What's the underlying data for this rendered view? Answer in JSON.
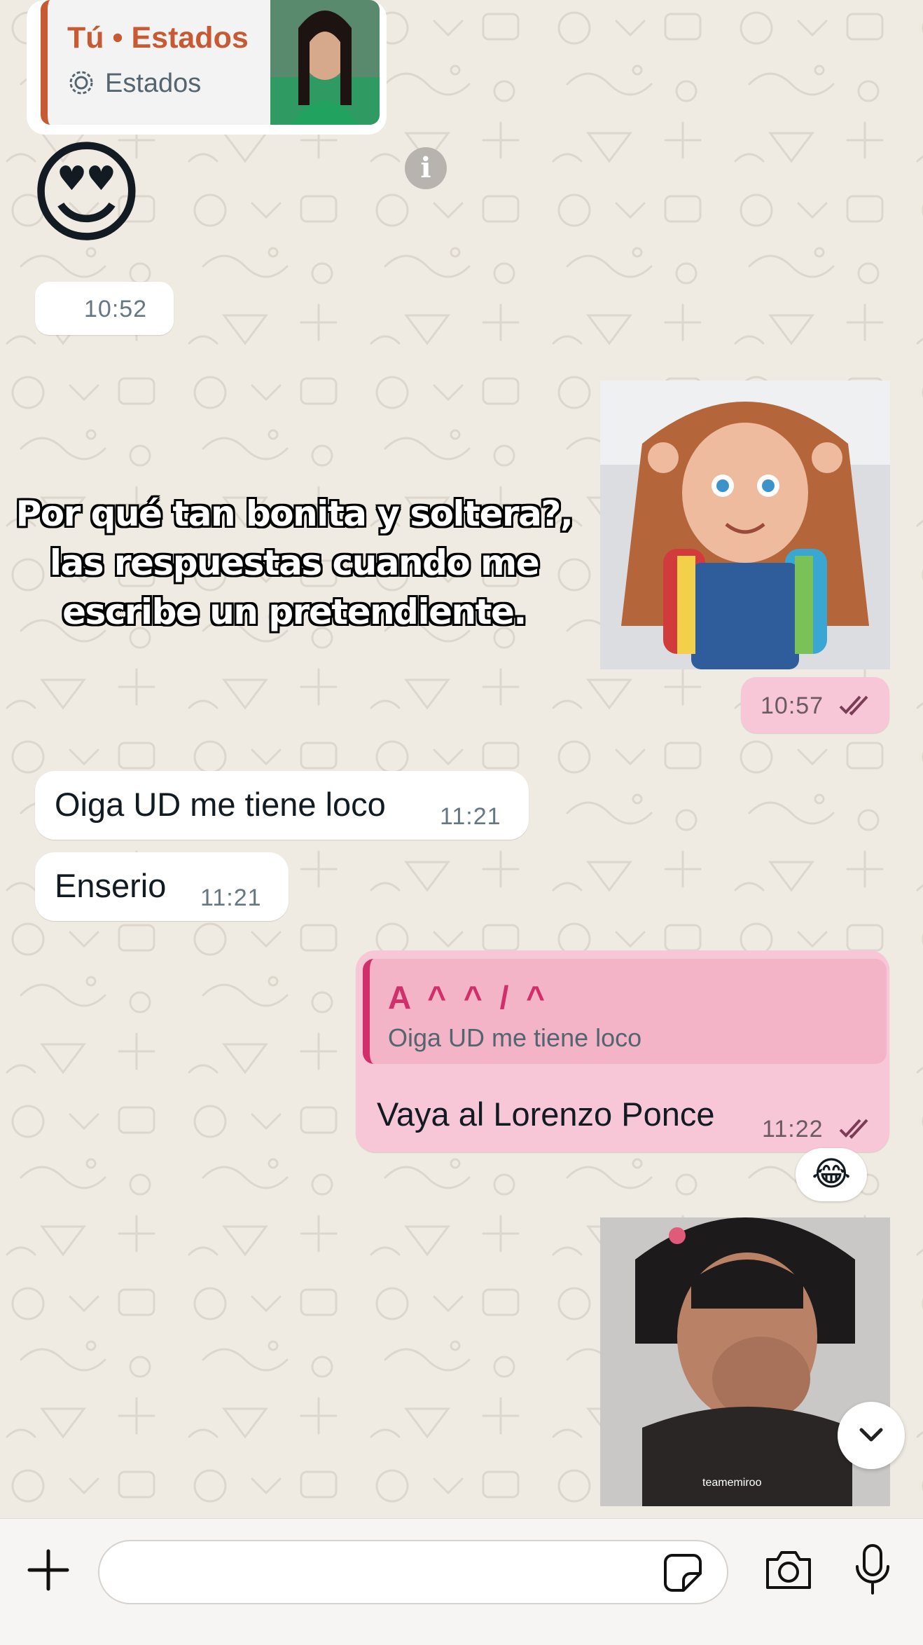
{
  "status_reply": {
    "title": "Tú • Estados",
    "subtitle": "Estados",
    "icons": [
      "status-ring-icon"
    ]
  },
  "messages": {
    "emoji_msg": {
      "emoji": "😍",
      "time": "10:52"
    },
    "meme_msg": {
      "caption_lines": [
        "Por qué tan bonita y soltera?,",
        "las respuestas cuando me",
        "escribe un pretendiente."
      ],
      "time": "10:57"
    },
    "msg_loco": {
      "text": "Oiga UD me tiene loco",
      "time": "11:21"
    },
    "msg_enserio": {
      "text": "Enserio",
      "time": "11:21"
    },
    "reply_msg": {
      "quoted_name": "A ^ ^ / ^",
      "quoted_text": "Oiga UD me tiene loco",
      "text": "Vaya al Lorenzo Ponce",
      "time": "11:22",
      "reaction": "😂"
    },
    "video_msg": {
      "watermark": "teamemiroo"
    }
  },
  "composer": {
    "icons": [
      "plus-icon",
      "sticker-icon",
      "camera-icon",
      "microphone-icon"
    ]
  },
  "colors": {
    "background": "#efeae2",
    "incoming_bubble": "#ffffff",
    "outgoing_bubble": "#f7c6d7",
    "accent_pink": "#d12f6c",
    "status_accent": "#c75a32",
    "read_ticks": "#7b3c55"
  }
}
